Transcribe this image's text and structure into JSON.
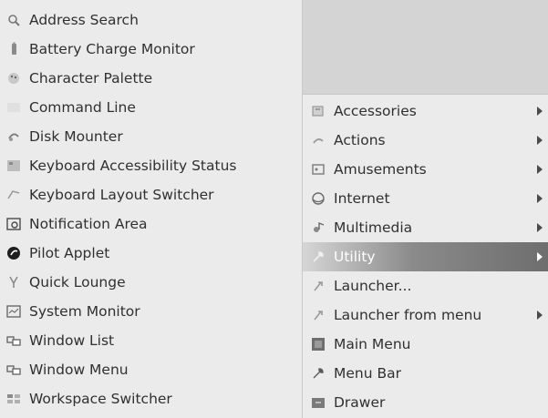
{
  "submenu": {
    "items": [
      {
        "label": "Address Search",
        "icon": "magnifier-icon"
      },
      {
        "label": "Battery Charge Monitor",
        "icon": "battery-icon"
      },
      {
        "label": "Character Palette",
        "icon": "palette-icon"
      },
      {
        "label": "Command Line",
        "icon": "terminal-icon"
      },
      {
        "label": "Disk Mounter",
        "icon": "disk-icon"
      },
      {
        "label": "Keyboard Accessibility Status",
        "icon": "keyboard-accessibility-icon"
      },
      {
        "label": "Keyboard Layout Switcher",
        "icon": "keyboard-layout-icon"
      },
      {
        "label": "Notification Area",
        "icon": "notification-area-icon"
      },
      {
        "label": "Pilot Applet",
        "icon": "pilot-icon"
      },
      {
        "label": "Quick Lounge",
        "icon": "quick-lounge-icon"
      },
      {
        "label": "System Monitor",
        "icon": "system-monitor-icon"
      },
      {
        "label": "Window List",
        "icon": "window-list-icon"
      },
      {
        "label": "Window Menu",
        "icon": "window-menu-icon"
      },
      {
        "label": "Workspace Switcher",
        "icon": "workspace-switcher-icon"
      }
    ]
  },
  "mainmenu": {
    "items": [
      {
        "label": "Accessories",
        "icon": "accessories-icon",
        "has_submenu": true
      },
      {
        "label": "Actions",
        "icon": "actions-icon",
        "has_submenu": true
      },
      {
        "label": "Amusements",
        "icon": "amusements-icon",
        "has_submenu": true
      },
      {
        "label": "Internet",
        "icon": "internet-icon",
        "has_submenu": true
      },
      {
        "label": "Multimedia",
        "icon": "multimedia-icon",
        "has_submenu": true
      },
      {
        "label": "Utility",
        "icon": "utility-icon",
        "has_submenu": true,
        "highlighted": true
      },
      {
        "label": "Launcher...",
        "icon": "launcher-icon",
        "has_submenu": false
      },
      {
        "label": "Launcher from menu",
        "icon": "launcher-from-menu-icon",
        "has_submenu": true
      },
      {
        "label": "Main Menu",
        "icon": "main-menu-icon",
        "has_submenu": false
      },
      {
        "label": "Menu Bar",
        "icon": "menu-bar-icon",
        "has_submenu": false
      },
      {
        "label": "Drawer",
        "icon": "drawer-icon",
        "has_submenu": false
      }
    ]
  },
  "colors": {
    "menu_background": "#ebebeb",
    "menu_text": "#303030",
    "highlight_start": "#d6d6d6",
    "highlight_end": "#6e6e6e",
    "highlight_text": "#ffffff",
    "blank_area": "#d4d4d4"
  }
}
